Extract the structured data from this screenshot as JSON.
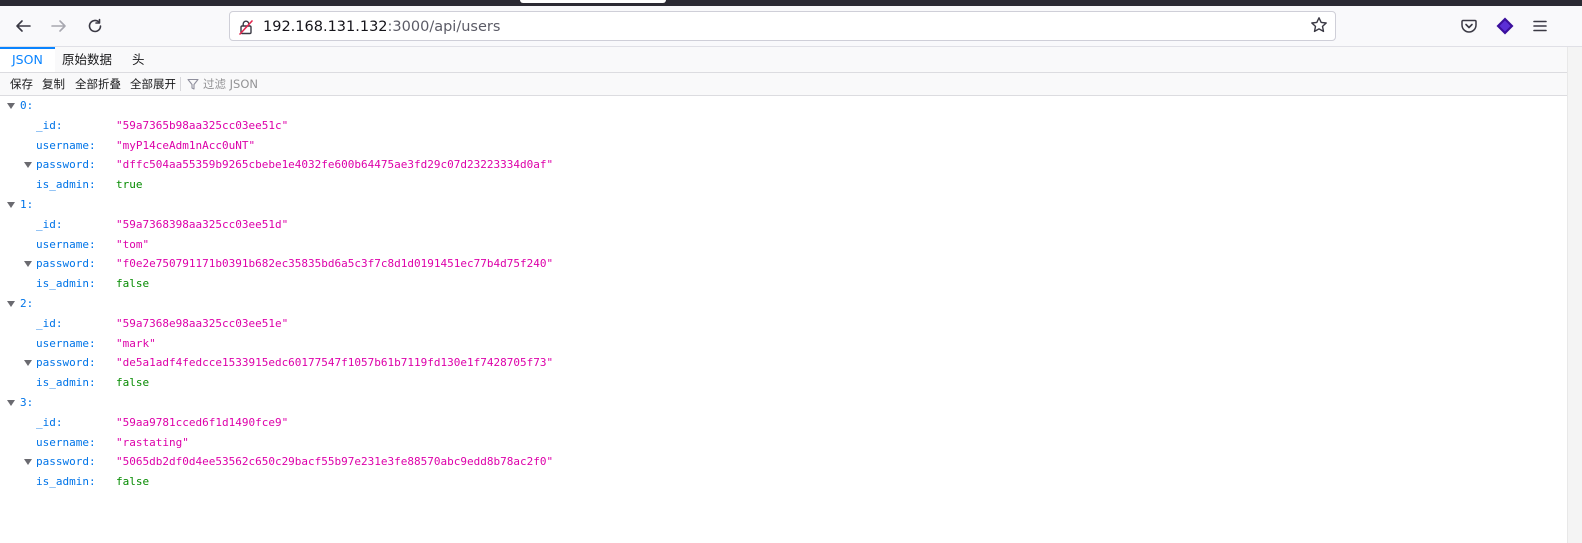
{
  "browser": {
    "url_host": "192.168.131.132",
    "url_path": ":3000/api/users"
  },
  "icons": {
    "back": "back-arrow-icon",
    "forward": "forward-arrow-icon",
    "reload": "reload-icon",
    "lock": "insecure-lock-icon",
    "bookmark": "bookmark-star-icon",
    "pocket": "pocket-icon",
    "extension": "extension-icon",
    "menu": "hamburger-menu-icon",
    "filter": "filter-icon"
  },
  "colors": {
    "key": "#0074e8",
    "string": "#dd00a9",
    "boolean": "#058b00",
    "accent": "#0a84ff",
    "extension": "#3b0f9c"
  },
  "tabs": [
    "JSON",
    "原始数据",
    "头"
  ],
  "toolbar": {
    "save": "保存",
    "copy": "复制",
    "collapse_all": "全部折叠",
    "expand_all": "全部展开",
    "filter_placeholder": "过滤 JSON"
  },
  "tree": {
    "items": [
      {
        "index": "0:",
        "fields": [
          {
            "key": "_id:",
            "value": "\"59a7365b98aa325cc03ee51c\""
          },
          {
            "key": "username:",
            "value": "\"myP14ceAdm1nAcc0uNT\""
          },
          {
            "key": "password:",
            "value": "\"dffc504aa55359b9265cbebe1e4032fe600b64475ae3fd29c07d23223334d0af\""
          },
          {
            "key": "is_admin:",
            "value": "true"
          }
        ]
      },
      {
        "index": "1:",
        "fields": [
          {
            "key": "_id:",
            "value": "\"59a7368398aa325cc03ee51d\""
          },
          {
            "key": "username:",
            "value": "\"tom\""
          },
          {
            "key": "password:",
            "value": "\"f0e2e750791171b0391b682ec35835bd6a5c3f7c8d1d0191451ec77b4d75f240\""
          },
          {
            "key": "is_admin:",
            "value": "false"
          }
        ]
      },
      {
        "index": "2:",
        "fields": [
          {
            "key": "_id:",
            "value": "\"59a7368e98aa325cc03ee51e\""
          },
          {
            "key": "username:",
            "value": "\"mark\""
          },
          {
            "key": "password:",
            "value": "\"de5a1adf4fedcce1533915edc60177547f1057b61b7119fd130e1f7428705f73\""
          },
          {
            "key": "is_admin:",
            "value": "false"
          }
        ]
      },
      {
        "index": "3:",
        "fields": [
          {
            "key": "_id:",
            "value": "\"59aa9781cced6f1d1490fce9\""
          },
          {
            "key": "username:",
            "value": "\"rastating\""
          },
          {
            "key": "password:",
            "value": "\"5065db2df0d4ee53562c650c29bacf55b97e231e3fe88570abc9edd8b78ac2f0\""
          },
          {
            "key": "is_admin:",
            "value": "false"
          }
        ]
      }
    ]
  }
}
